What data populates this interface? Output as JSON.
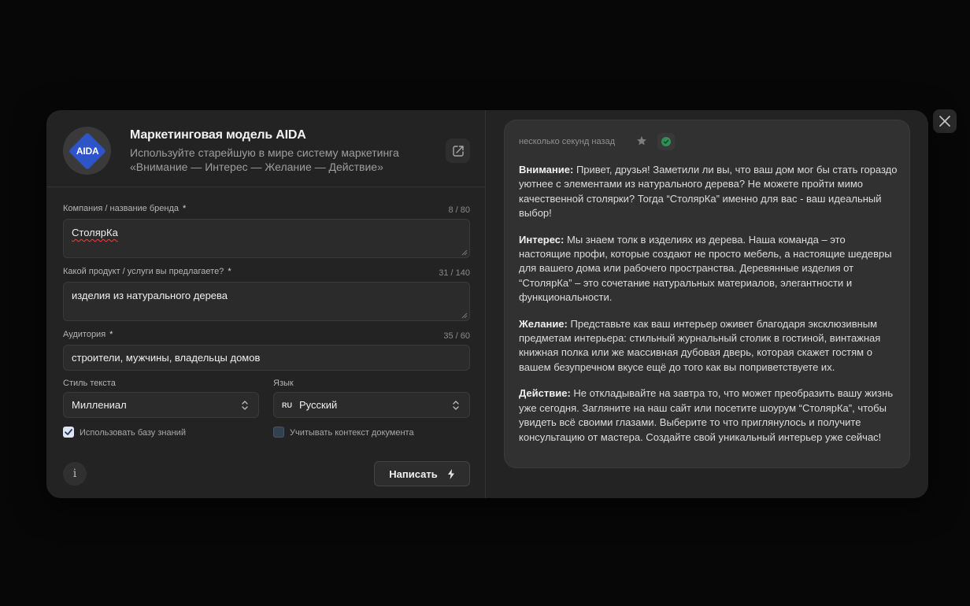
{
  "header": {
    "logo_text": "AIDA",
    "title": "Маркетинговая модель AIDA",
    "description": "Используйте старейшую в мире систему маркетинга «Внимание — Интерес — Желание — Действие»"
  },
  "form": {
    "company": {
      "label": "Компания / название бренда",
      "required_mark": "*",
      "counter": "8 / 80",
      "value": "СтолярКа"
    },
    "product": {
      "label": "Какой продукт / услуги вы предлагаете?",
      "required_mark": "*",
      "counter": "31 / 140",
      "value": "изделия из натурального дерева"
    },
    "audience": {
      "label": "Аудитория",
      "required_mark": "*",
      "counter": "35 / 60",
      "value": "строители, мужчины, владельцы домов"
    },
    "style": {
      "label": "Стиль текста",
      "value": "Миллениал"
    },
    "language": {
      "label": "Язык",
      "code": "RU",
      "value": "Русский"
    },
    "knowledge_base": {
      "label": "Использовать базу знаний",
      "checked": true
    },
    "doc_context": {
      "label": "Учитывать контекст документа",
      "checked": false
    },
    "submit_label": "Написать",
    "info_glyph": "i"
  },
  "result": {
    "timestamp": "несколько секунд назад",
    "sections": [
      {
        "heading": "Внимание:",
        "text": "Привет, друзья! Заметили ли вы, что ваш дом мог бы стать гораздо уютнее с элементами из натурального дерева? Не можете пройти мимо качественной столярки? Тогда “СтолярКа” именно для вас - ваш идеальный выбор!"
      },
      {
        "heading": "Интерес:",
        "text": "Мы знаем толк в изделиях из дерева. Наша команда – это настоящие профи, которые создают не просто мебель, а настоящие шедевры для вашего дома или рабочего пространства. Деревянные изделия от “СтолярКа” – это сочетание натуральных материалов, элегантности и функциональности."
      },
      {
        "heading": "Желание:",
        "text": "Представьте как ваш интерьер оживет благодаря эксклюзивным предметам интерьера: стильный журнальный столик в гостиной, винтажная книжная полка или же массивная дубовая дверь, которая скажет гостям о вашем безупречном вкусе ещё до того как вы поприветствуете их."
      },
      {
        "heading": "Действие:",
        "text": "Не откладывайте на завтра то, что может преобразить вашу жизнь уже сегодня. Загляните на наш сайт или посетите шоурум “СтолярКа”, чтобы увидеть всё своими глазами. Выберите то что приглянулось и получите консультацию от мастера. Создайте свой уникальный интерьер уже сейчас!"
      }
    ]
  },
  "icons": {
    "close": "close-icon",
    "share": "share-icon",
    "star": "star-icon",
    "success": "check-circle-icon",
    "bolt": "lightning-icon",
    "info": "info-icon",
    "check": "check-icon",
    "updown": "chevron-updown-icon"
  },
  "colors": {
    "modal_bg": "#232323",
    "card_bg": "#313131",
    "logo_brand": "#2e55c8",
    "success_green": "#2f8f55"
  }
}
